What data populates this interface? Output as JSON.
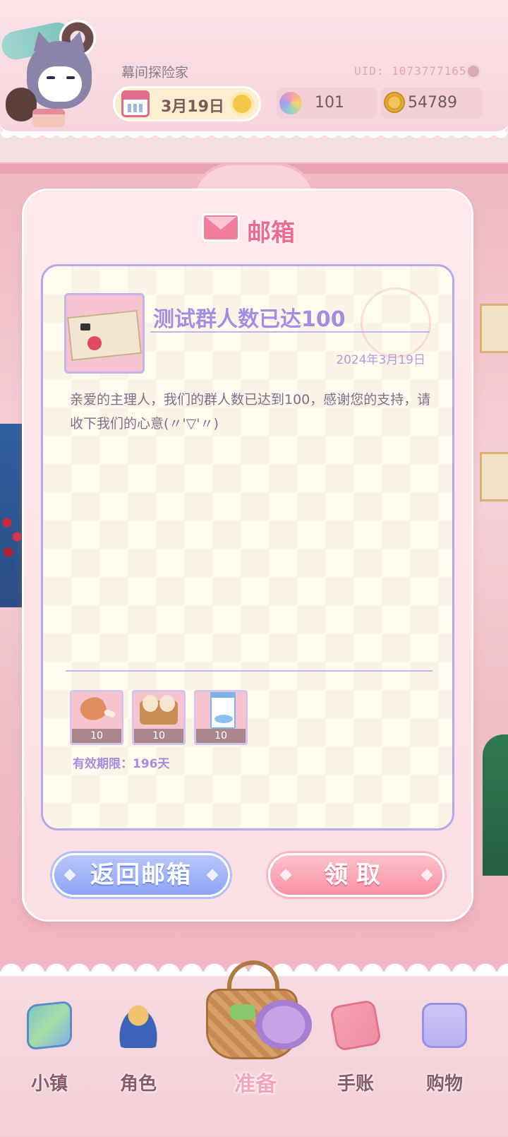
{
  "hud": {
    "player_name": "幕间探险家",
    "uid": "UID: 1073777165",
    "date": "3月19日",
    "gems": "101",
    "coins": "54789"
  },
  "mailbox": {
    "title": "邮箱",
    "mail": {
      "subject": "测试群人数已达100",
      "date": "2024年3月19日",
      "body": "亲爱的主理人，我们的群人数已达到100，感谢您的支持，请收下我们的心意(〃'▽'〃)",
      "rewards": [
        {
          "icon": "drumstick-icon",
          "count": "10"
        },
        {
          "icon": "eggs-icon",
          "count": "10"
        },
        {
          "icon": "milk-icon",
          "count": "10"
        }
      ],
      "expiry": "有效期限：196天"
    },
    "back_button": "返回邮箱",
    "claim_button": "领取"
  },
  "nav": {
    "items": [
      {
        "label": "小镇",
        "icon": "map-icon"
      },
      {
        "label": "角色",
        "icon": "character-icon"
      },
      {
        "label": "准备",
        "icon": "basket-icon"
      },
      {
        "label": "手账",
        "icon": "journal-icon"
      },
      {
        "label": "购物",
        "icon": "shopping-bag-icon"
      }
    ]
  },
  "colors": {
    "title_pink": "#ee6b8f",
    "subject_purple": "#a58ce0",
    "back_button_blue": "#8ea4f4",
    "claim_button_pink": "#f791a4",
    "letter_border": "#b6a8ea"
  }
}
